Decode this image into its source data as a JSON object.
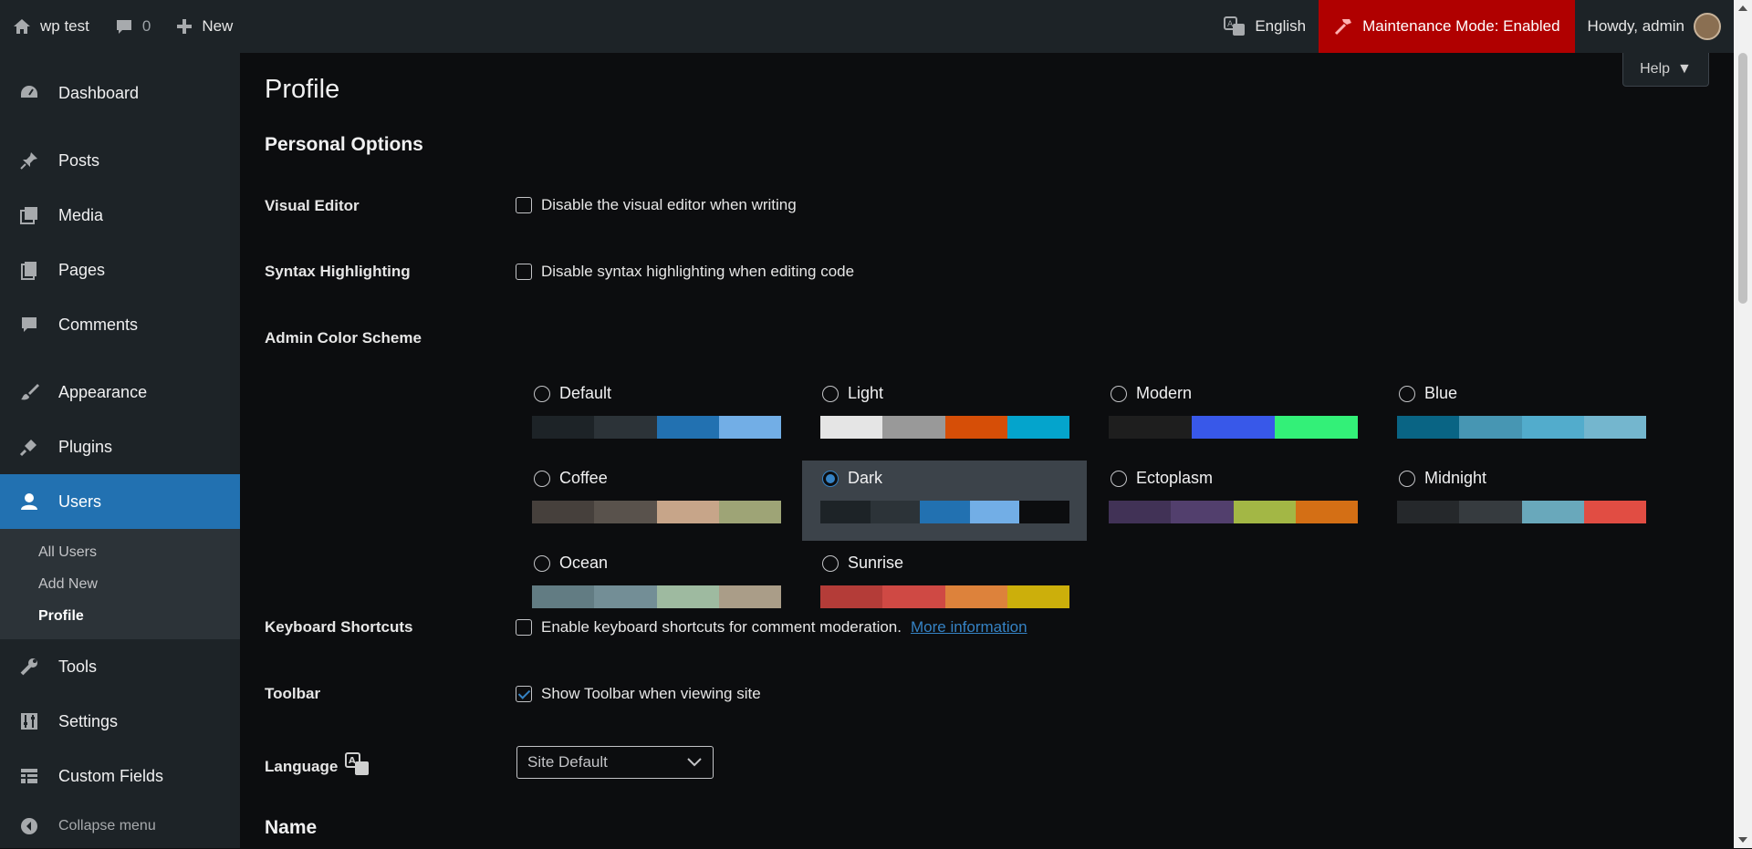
{
  "adminbar": {
    "site_name": "wp test",
    "comments_count": "0",
    "new_label": "New",
    "language": "English",
    "maintenance": "Maintenance Mode: Enabled",
    "greeting": "Howdy, admin"
  },
  "sidebar": {
    "items": [
      {
        "label": "Dashboard",
        "icon": "dashboard-icon"
      },
      {
        "label": "Posts",
        "icon": "pin-icon"
      },
      {
        "label": "Media",
        "icon": "media-icon"
      },
      {
        "label": "Pages",
        "icon": "pages-icon"
      },
      {
        "label": "Comments",
        "icon": "comment-icon"
      },
      {
        "label": "Appearance",
        "icon": "brush-icon"
      },
      {
        "label": "Plugins",
        "icon": "plug-icon"
      },
      {
        "label": "Users",
        "icon": "user-icon"
      },
      {
        "label": "Tools",
        "icon": "wrench-icon"
      },
      {
        "label": "Settings",
        "icon": "sliders-icon"
      },
      {
        "label": "Custom Fields",
        "icon": "table-icon"
      }
    ],
    "submenu": [
      "All Users",
      "Add New",
      "Profile"
    ],
    "collapse": "Collapse menu"
  },
  "main": {
    "help": "Help",
    "title": "Profile",
    "personal_options": "Personal Options",
    "visual_editor": {
      "label": "Visual Editor",
      "text": "Disable the visual editor when writing",
      "checked": false
    },
    "syntax": {
      "label": "Syntax Highlighting",
      "text": "Disable syntax highlighting when editing code",
      "checked": false
    },
    "color_scheme_label": "Admin Color Scheme",
    "schemes": [
      {
        "name": "Default",
        "colors": [
          "#1d2327",
          "#2c3338",
          "#2271b1",
          "#72aee6"
        ],
        "selected": false
      },
      {
        "name": "Light",
        "colors": [
          "#e5e5e5",
          "#999999",
          "#d64e07",
          "#04a4cc"
        ],
        "selected": false
      },
      {
        "name": "Modern",
        "colors": [
          "#1e1e1e",
          "#3858e9",
          "#33f078"
        ],
        "selected": false
      },
      {
        "name": "Blue",
        "colors": [
          "#096484",
          "#4796b3",
          "#52accc",
          "#74b6ce"
        ],
        "selected": false
      },
      {
        "name": "Coffee",
        "colors": [
          "#46403c",
          "#59524c",
          "#c7a589",
          "#9ea476"
        ],
        "selected": false
      },
      {
        "name": "Dark",
        "colors": [
          "#1d2327",
          "#2c3338",
          "#2271b1",
          "#72aee6",
          "#0c0d0f"
        ],
        "selected": true
      },
      {
        "name": "Ectoplasm",
        "colors": [
          "#413256",
          "#523f6d",
          "#a3b745",
          "#d46f15"
        ],
        "selected": false
      },
      {
        "name": "Midnight",
        "colors": [
          "#25282b",
          "#363b3f",
          "#69a8bb",
          "#e14d43"
        ],
        "selected": false
      },
      {
        "name": "Ocean",
        "colors": [
          "#627c83",
          "#738e96",
          "#9ebaa0",
          "#aa9d88"
        ],
        "selected": false
      },
      {
        "name": "Sunrise",
        "colors": [
          "#b43c38",
          "#cf4944",
          "#dd823b",
          "#ccaf0b"
        ],
        "selected": false
      }
    ],
    "keyboard": {
      "label": "Keyboard Shortcuts",
      "text": "Enable keyboard shortcuts for comment moderation.",
      "link": "More information",
      "checked": false
    },
    "toolbar": {
      "label": "Toolbar",
      "text": "Show Toolbar when viewing site",
      "checked": true
    },
    "language": {
      "label": "Language",
      "value": "Site Default"
    },
    "name_heading": "Name"
  }
}
